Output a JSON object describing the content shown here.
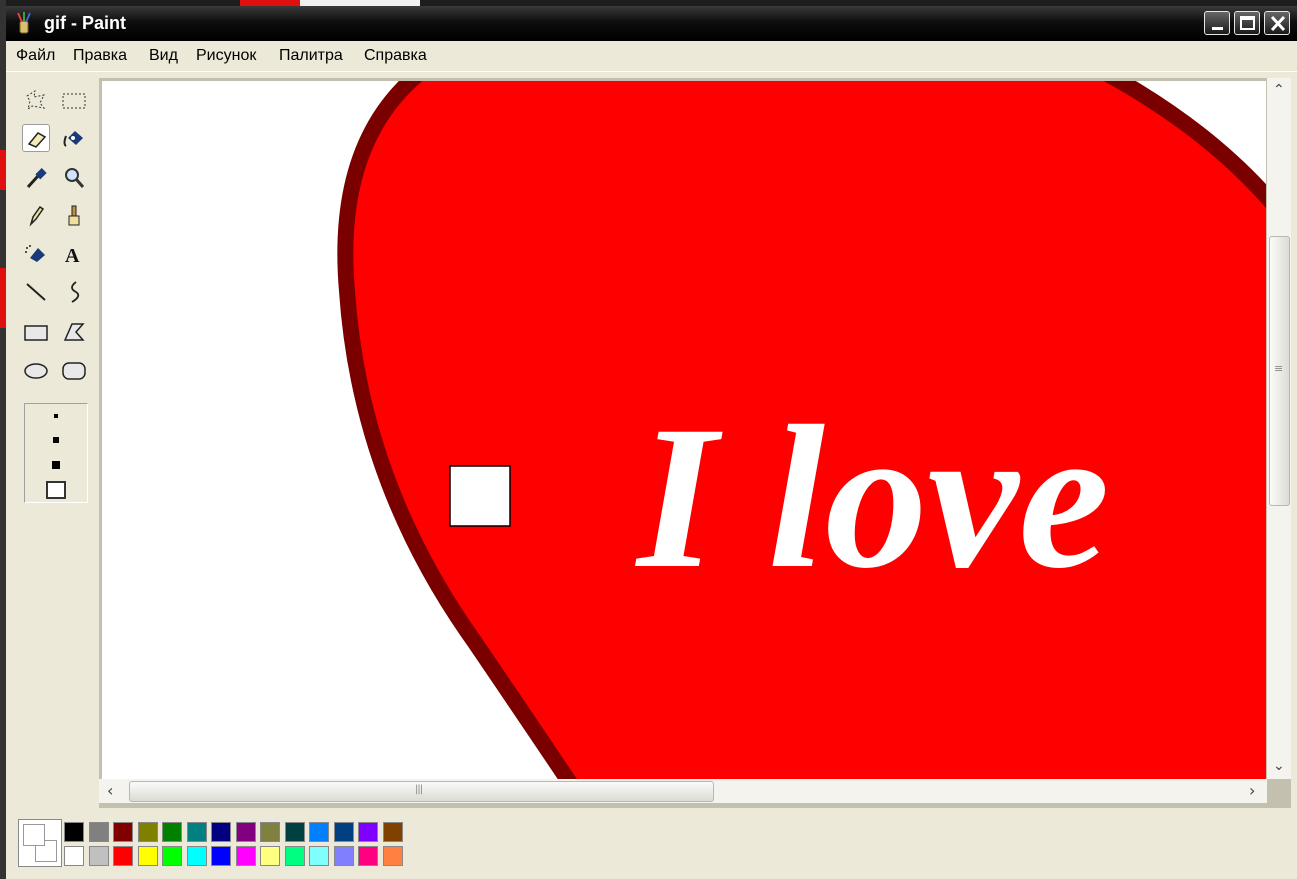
{
  "window": {
    "title": "gif - Paint"
  },
  "menu": [
    "Файл",
    "Правка",
    "Вид",
    "Рисунок",
    "Палитра",
    "Справка"
  ],
  "tools": [
    {
      "name": "free-select-icon",
      "selected": false
    },
    {
      "name": "rect-select-icon",
      "selected": false
    },
    {
      "name": "eraser-icon",
      "selected": true
    },
    {
      "name": "fill-bucket-icon",
      "selected": false
    },
    {
      "name": "color-picker-icon",
      "selected": false
    },
    {
      "name": "magnifier-icon",
      "selected": false
    },
    {
      "name": "pencil-icon",
      "selected": false
    },
    {
      "name": "brush-icon",
      "selected": false
    },
    {
      "name": "airbrush-icon",
      "selected": false
    },
    {
      "name": "text-icon",
      "selected": false
    },
    {
      "name": "line-icon",
      "selected": false
    },
    {
      "name": "curve-icon",
      "selected": false
    },
    {
      "name": "rectangle-icon",
      "selected": false
    },
    {
      "name": "polygon-icon",
      "selected": false
    },
    {
      "name": "ellipse-icon",
      "selected": false
    },
    {
      "name": "rounded-rect-icon",
      "selected": false
    }
  ],
  "text_tool_glyph": "A",
  "canvas": {
    "text": "I love",
    "heart_fill": "#ff0000",
    "heart_outline": "#7a0000",
    "text_color": "#ffffff"
  },
  "colors": {
    "current_foreground": "#ffffff",
    "current_background": "#ffffff",
    "palette_top": [
      "#000000",
      "#808080",
      "#800000",
      "#808000",
      "#008000",
      "#008080",
      "#000080",
      "#800080",
      "#808040",
      "#004040",
      "#0080ff",
      "#004080",
      "#8000ff",
      "#804000"
    ],
    "palette_bottom": [
      "#ffffff",
      "#c0c0c0",
      "#ff0000",
      "#ffff00",
      "#00ff00",
      "#00ffff",
      "#0000ff",
      "#ff00ff",
      "#ffff80",
      "#00ff80",
      "#80ffff",
      "#8080ff",
      "#ff0080",
      "#ff8040"
    ]
  }
}
